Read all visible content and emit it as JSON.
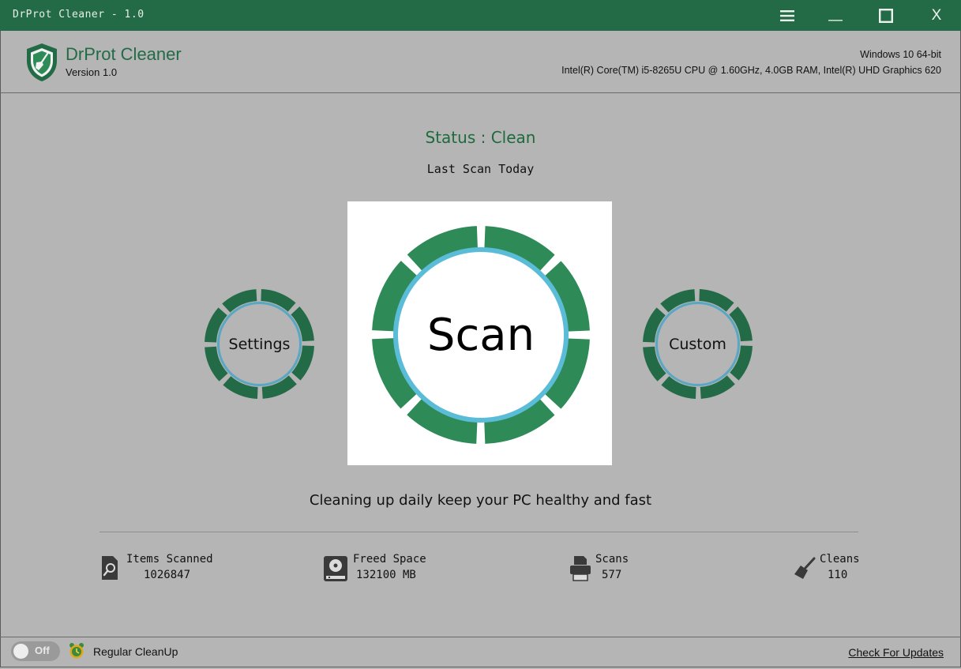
{
  "window": {
    "title": "DrProt Cleaner - 1.0",
    "menu_icon": "hamburger-menu-icon",
    "minimize_icon": "minimize-icon",
    "maximize_icon": "maximize-icon",
    "close_label": "X"
  },
  "header": {
    "app_name": "DrProt Cleaner",
    "version": "Version 1.0",
    "os": "Windows 10 64-bit",
    "hardware": "Intel(R) Core(TM) i5-8265U CPU @ 1.60GHz, 4.0GB RAM, Intel(R) UHD Graphics 620"
  },
  "main": {
    "status": "Status : Clean",
    "last_scan": "Last Scan Today",
    "settings_label": "Settings",
    "scan_label": "Scan",
    "custom_label": "Custom",
    "tagline": "Cleaning up daily keep your PC healthy and fast"
  },
  "stats": [
    {
      "label": "Items Scanned",
      "value": "1026847",
      "icon": "search-document-icon"
    },
    {
      "label": "Freed Space",
      "value": "132100 MB",
      "icon": "hard-drive-icon"
    },
    {
      "label": "Scans",
      "value": "577",
      "icon": "printer-icon"
    },
    {
      "label": "Cleans",
      "value": "110",
      "icon": "broom-icon"
    }
  ],
  "footer": {
    "toggle_state": "Off",
    "schedule_label": "Regular CleanUp",
    "updates_link": "Check For Updates"
  },
  "colors": {
    "titlebar": "#236b47",
    "ring_green": "#2e8b57",
    "ring_inner": "#5bbcd8",
    "background": "#b5b5b5"
  }
}
